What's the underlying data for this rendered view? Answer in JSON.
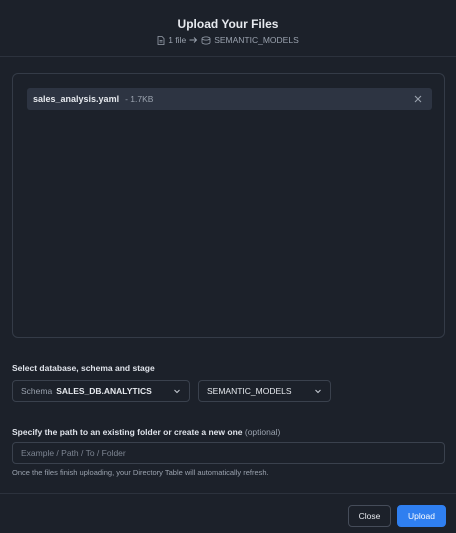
{
  "header": {
    "title": "Upload Your Files",
    "file_count": "1 file",
    "destination": "SEMANTIC_MODELS"
  },
  "files": [
    {
      "name": "sales_analysis.yaml",
      "size": "- 1.7KB"
    }
  ],
  "location": {
    "label": "Select database, schema and stage",
    "schema_prefix": "Schema",
    "schema_value": "SALES_DB.ANALYTICS",
    "stage_value": "SEMANTIC_MODELS"
  },
  "path": {
    "label": "Specify the path to an existing folder or create a new one",
    "optional": "(optional)",
    "placeholder": "Example / Path / To / Folder",
    "hint": "Once the files finish uploading, your Directory Table will automatically refresh."
  },
  "footer": {
    "close_label": "Close",
    "upload_label": "Upload"
  },
  "colors": {
    "background": "#1c212a",
    "accent": "#2f7ff0"
  },
  "icons": {
    "file": "file-icon",
    "arrow": "arrow-right-icon",
    "stage": "stage-icon",
    "remove": "close-icon",
    "chevron": "chevron-down-icon"
  }
}
